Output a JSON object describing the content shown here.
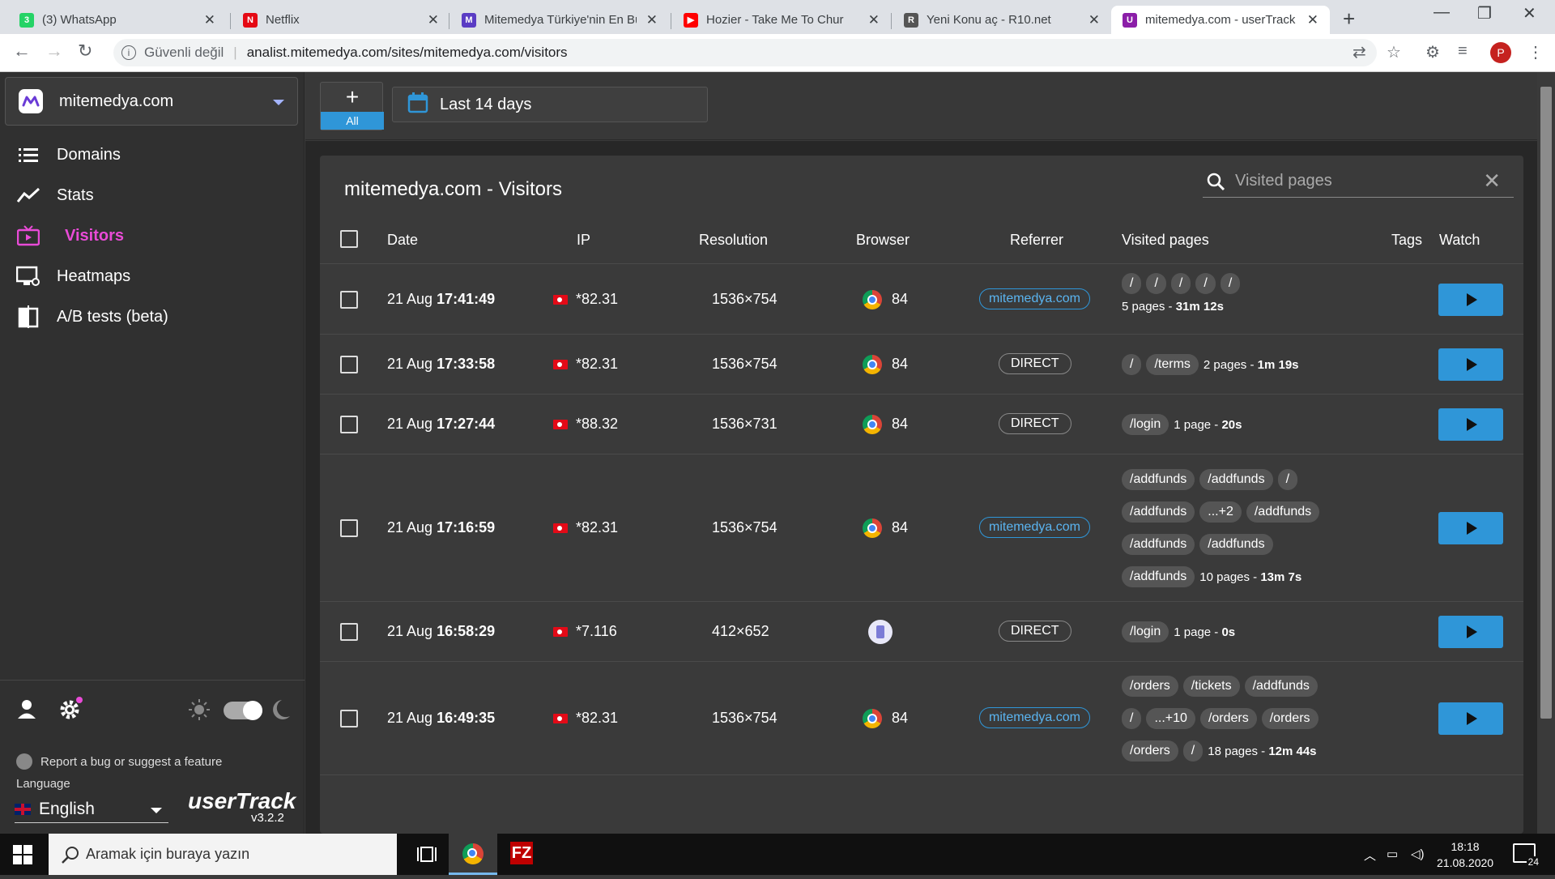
{
  "browser": {
    "tabs": [
      {
        "title": "(3) WhatsApp",
        "fav_color": "#25d366",
        "fav_glyph": "3",
        "active": false
      },
      {
        "title": "Netflix",
        "fav_color": "#e50914",
        "fav_glyph": "N",
        "active": false
      },
      {
        "title": "Mitemedya Türkiye'nin En Bü",
        "fav_color": "#5a3cc4",
        "fav_glyph": "M",
        "active": false
      },
      {
        "title": "Hozier - Take Me To Chur",
        "fav_color": "#ff0000",
        "fav_glyph": "▶",
        "active": false
      },
      {
        "title": "Yeni Konu aç - R10.net",
        "fav_color": "#555555",
        "fav_glyph": "R",
        "active": false
      },
      {
        "title": "mitemedya.com - userTrack",
        "fav_color": "#8b1ea8",
        "fav_glyph": "U",
        "active": true
      }
    ],
    "security_label": "Güvenli değil",
    "url": "analist.mitemedya.com/sites/mitemedya.com/visitors",
    "profile_initial": "P"
  },
  "sidebar": {
    "site_name": "mitemedya.com",
    "menu": [
      {
        "label": "Domains",
        "icon": "list-icon",
        "active": false
      },
      {
        "label": "Stats",
        "icon": "trend-icon",
        "active": false
      },
      {
        "label": "Visitors",
        "icon": "tv-icon",
        "active": true
      },
      {
        "label": "Heatmaps",
        "icon": "heatmap-icon",
        "active": false
      },
      {
        "label": "A/B tests (beta)",
        "icon": "ab-icon",
        "active": false
      }
    ],
    "report_bug": "Report a bug or suggest a feature",
    "language_label": "Language",
    "language_value": "English",
    "brand": "userTrack",
    "version": "v3.2.2",
    "accent": "#e94bd7"
  },
  "toolbar": {
    "add_label": "+",
    "all_label": "All",
    "date_range": "Last 14 days"
  },
  "visitors": {
    "title": "mitemedya.com - Visitors",
    "search_placeholder": "Visited pages",
    "columns": {
      "date": "Date",
      "ip": "IP",
      "resolution": "Resolution",
      "browser": "Browser",
      "referrer": "Referrer",
      "pages": "Visited pages",
      "tags": "Tags",
      "watch": "Watch"
    },
    "rows": [
      {
        "date": "21 Aug",
        "time": "17:41:49",
        "ip": "*82.31",
        "res": "1536×754",
        "browser": "84",
        "browser_type": "chrome",
        "ref": "mitemedya.com",
        "ref_type": "link",
        "page_lines": [
          [
            "/",
            "/",
            "/",
            "/",
            "/"
          ]
        ],
        "summary_pages": "5 pages - ",
        "summary_time": "31m 12s",
        "summary_on_last": false
      },
      {
        "date": "21 Aug",
        "time": "17:33:58",
        "ip": "*82.31",
        "res": "1536×754",
        "browser": "84",
        "browser_type": "chrome",
        "ref": "DIRECT",
        "ref_type": "direct",
        "page_lines": [
          [
            "/",
            "/terms"
          ]
        ],
        "summary_pages": "2 pages - ",
        "summary_time": "1m 19s",
        "summary_on_last": true
      },
      {
        "date": "21 Aug",
        "time": "17:27:44",
        "ip": "*88.32",
        "res": "1536×731",
        "browser": "84",
        "browser_type": "chrome",
        "ref": "DIRECT",
        "ref_type": "direct",
        "page_lines": [
          [
            "/login"
          ]
        ],
        "summary_pages": "1 page - ",
        "summary_time": "20s",
        "summary_on_last": true
      },
      {
        "date": "21 Aug",
        "time": "17:16:59",
        "ip": "*82.31",
        "res": "1536×754",
        "browser": "84",
        "browser_type": "chrome",
        "ref": "mitemedya.com",
        "ref_type": "link",
        "page_lines": [
          [
            "/addfunds",
            "/addfunds",
            "/"
          ],
          [
            "/addfunds",
            "...+2",
            "/addfunds"
          ],
          [
            "/addfunds",
            "/addfunds"
          ],
          [
            "/addfunds"
          ]
        ],
        "summary_pages": "10 pages - ",
        "summary_time": "13m 7s",
        "summary_on_last": true
      },
      {
        "date": "21 Aug",
        "time": "16:58:29",
        "ip": "*7.116",
        "res": "412×652",
        "browser": "",
        "browser_type": "mobile",
        "ref": "DIRECT",
        "ref_type": "direct",
        "page_lines": [
          [
            "/login"
          ]
        ],
        "summary_pages": "1 page - ",
        "summary_time": "0s",
        "summary_on_last": true
      },
      {
        "date": "21 Aug",
        "time": "16:49:35",
        "ip": "*82.31",
        "res": "1536×754",
        "browser": "84",
        "browser_type": "chrome",
        "ref": "mitemedya.com",
        "ref_type": "link",
        "page_lines": [
          [
            "/orders",
            "/tickets",
            "/addfunds"
          ],
          [
            "/",
            "...+10",
            "/orders",
            "/orders"
          ],
          [
            "/orders",
            "/"
          ]
        ],
        "summary_pages": "18 pages - ",
        "summary_time": "12m 44s",
        "summary_on_last": true
      }
    ]
  },
  "taskbar": {
    "search_placeholder": "Aramak için buraya yazın",
    "time": "18:18",
    "date": "21.08.2020",
    "notif_count": "24"
  }
}
